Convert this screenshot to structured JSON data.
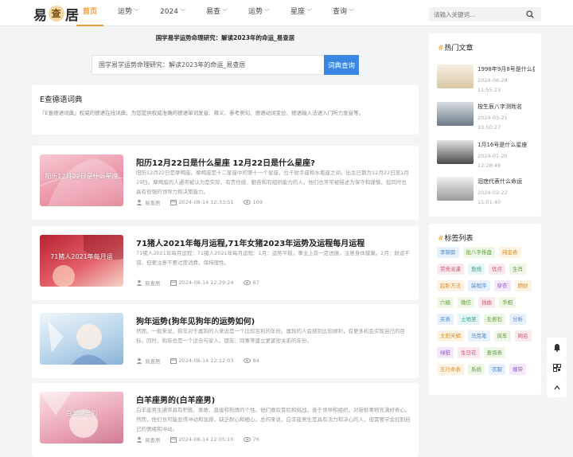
{
  "header": {
    "logo_left": "易",
    "logo_mid": "查",
    "logo_right": "居",
    "nav": [
      {
        "label": "首页",
        "active": true,
        "dropdown": false
      },
      {
        "label": "运势",
        "active": false,
        "dropdown": true
      },
      {
        "label": "2024",
        "active": false,
        "dropdown": true
      },
      {
        "label": "易查",
        "active": false,
        "dropdown": true
      },
      {
        "label": "运势",
        "active": false,
        "dropdown": true
      },
      {
        "label": "星座",
        "active": false,
        "dropdown": true
      },
      {
        "label": "查询",
        "active": false,
        "dropdown": true
      }
    ],
    "search_placeholder": "请输入关键词...",
    "search_icon": "search-icon"
  },
  "hero": {
    "title": "国学易学运势命理研究：解读2023年的命运_易查居",
    "input_value": "国学易学运势命理研究：解读2023年的命运_易查居",
    "button_label": "词典查询"
  },
  "dictionary": {
    "title": "E查德语词典",
    "description": "『E查德语词典』权威的德语在线词典，为您提供权威准确的德语单词发音、释义、参考例句、德语动词变位、德语输入法语入门听力发音等。"
  },
  "posts": [
    {
      "title": "阳历12月22日是什么星座 12月22日是什么星座?",
      "summary": "阳历12月22日是摩羯座。摩羯座是十二星座中的第十一个星座，位于射手座和水瓶座之间，出生日期为12月22日至1月19日。摩羯座的人通常被认为是实际、有责任感、勤奋和有组织能力的人。他们也常常被描述为保守和谨慎，但同时也具有很强的领导力和决策能力。",
      "author": "易查居",
      "date": "2024-08-14 12:33:51",
      "views": "109",
      "thumb_caption": "阳历12月22日是什么星座",
      "thumb_colors": [
        "#f6b8c3",
        "#e87f95"
      ]
    },
    {
      "title": "71猪人2021年每月运程,71年女猪2023年运势及运程每月运程",
      "summary": "71猪人2021年每月运程：71猪人2021年每月运程：1月：运势平稳，事业上有一定进展，注意身体健康。2月：财运不错，但要注意不要过度消费，保持理性。",
      "author": "易查居",
      "date": "2024-08-14 12:29:24",
      "views": "87",
      "thumb_caption": "71猪人2021年每月运",
      "thumb_colors": [
        "#c9303b",
        "#e9a9a0"
      ]
    },
    {
      "title": "狗年运势(狗年见狗年的运势如何)",
      "summary": "然而，一般来说，狗年对于属狗的人来说是一个比较吉利的年份。属狗的人会感到比较顺利，有更多机会实现自己的目标。同时，狗年也是一个适合与家人、朋友、同事等建立更紧密关系的年份。",
      "author": "易查居",
      "date": "2024-08-14 12:12:03",
      "views": "84",
      "thumb_caption": "",
      "thumb_colors": [
        "#d7e8f4",
        "#9dc3df"
      ]
    },
    {
      "title": "白羊座男的(白羊座男)",
      "summary": "白羊座男生通常具有积极、勇敢、直接和热情的个性。他们喜欢冒险和挑战，善于领导和组织，对新鲜事物充满好奇心。然而，他们也可能显得冲动和急躁，缺乏耐心和细心。总的来说，白羊座男生是具有活力和决心的人，但需要学会控制自己的情绪和冲动。",
      "author": "易查居",
      "date": "2024-08-14 12:05:10",
      "views": "76",
      "thumb_caption": "白羊座男的",
      "thumb_colors": [
        "#f3c6cf",
        "#d98aa0"
      ]
    }
  ],
  "sidebar": {
    "hot_title": "热门文章",
    "hot": [
      {
        "title": "1998年9月8号是什么星座",
        "date": "2024-06-28 11:55:23"
      },
      {
        "title": "按生辰八字测姓名",
        "date": "2024-03-21 10:50:27"
      },
      {
        "title": "1月16号是什么星座",
        "date": "2024-01-20 12:28:49"
      },
      {
        "title": "泪痣代表什么命运",
        "date": "2024-02-22 15:01:40"
      }
    ],
    "tags_title": "标签列表",
    "tags": [
      {
        "label": "李锦葵",
        "bg": "#e8f1fb",
        "fg": "#4a86c8"
      },
      {
        "label": "批八字排盘",
        "bg": "#eef7e6",
        "fg": "#5d9b3a"
      },
      {
        "label": "纯金表",
        "bg": "#fdf3e2",
        "fg": "#d88c2a"
      },
      {
        "label": "劳务派遣",
        "bg": "#fbe9ee",
        "fg": "#d0566f"
      },
      {
        "label": "鱼线",
        "bg": "#e6f6f4",
        "fg": "#2f9d8e"
      },
      {
        "label": "优点",
        "bg": "#fbe9ee",
        "fg": "#d0566f"
      },
      {
        "label": "生肖",
        "bg": "#eef7e6",
        "fg": "#5d9b3a"
      },
      {
        "label": "起卧方法",
        "bg": "#fdf3e2",
        "fg": "#d88c2a"
      },
      {
        "label": "装程序",
        "bg": "#e8f1fb",
        "fg": "#4a86c8"
      },
      {
        "label": "穿衣",
        "bg": "#f3e9fb",
        "fg": "#9458c9"
      },
      {
        "label": "朗财",
        "bg": "#fdf3e2",
        "fg": "#d88c2a"
      },
      {
        "label": "六级",
        "bg": "#eef7e6",
        "fg": "#5d9b3a"
      },
      {
        "label": "微信",
        "bg": "#eef7e6",
        "fg": "#5d9b3a"
      },
      {
        "label": "插曲",
        "bg": "#fbe9ee",
        "fg": "#d0566f"
      },
      {
        "label": "手相",
        "bg": "#eef7e6",
        "fg": "#5d9b3a"
      },
      {
        "label": "买表",
        "bg": "#e8f1fb",
        "fg": "#4a86c8"
      },
      {
        "label": "土地至",
        "bg": "#e6f6f4",
        "fg": "#2f9d8e"
      },
      {
        "label": "生辰石",
        "bg": "#eef7e6",
        "fg": "#5d9b3a"
      },
      {
        "label": "分析",
        "bg": "#e8f1fb",
        "fg": "#4a86c8"
      },
      {
        "label": "太阳天蝎",
        "bg": "#fdf3e2",
        "fg": "#d88c2a"
      },
      {
        "label": "马克笔",
        "bg": "#e8f1fb",
        "fg": "#4a86c8"
      },
      {
        "label": "风车",
        "bg": "#eef7e6",
        "fg": "#5d9b3a"
      },
      {
        "label": "网名",
        "bg": "#fbe9ee",
        "fg": "#d0566f"
      },
      {
        "label": "绿脏",
        "bg": "#f3e9fb",
        "fg": "#9458c9"
      },
      {
        "label": "生日花",
        "bg": "#fbe9ee",
        "fg": "#d0566f"
      },
      {
        "label": "查询表",
        "bg": "#eef7e6",
        "fg": "#5d9b3a"
      },
      {
        "label": "五行命表",
        "bg": "#fdf3e2",
        "fg": "#d88c2a"
      },
      {
        "label": "系统",
        "bg": "#eef7e6",
        "fg": "#5d9b3a"
      },
      {
        "label": "衣服",
        "bg": "#e8f1fb",
        "fg": "#4a86c8"
      },
      {
        "label": "缠带",
        "bg": "#f3e9fb",
        "fg": "#9458c9"
      }
    ]
  },
  "float_buttons": [
    "bell-icon",
    "qrcode-icon",
    "back-to-top-icon"
  ],
  "colors": {
    "accent": "#f29b38",
    "button_blue": "#3a86e0"
  }
}
